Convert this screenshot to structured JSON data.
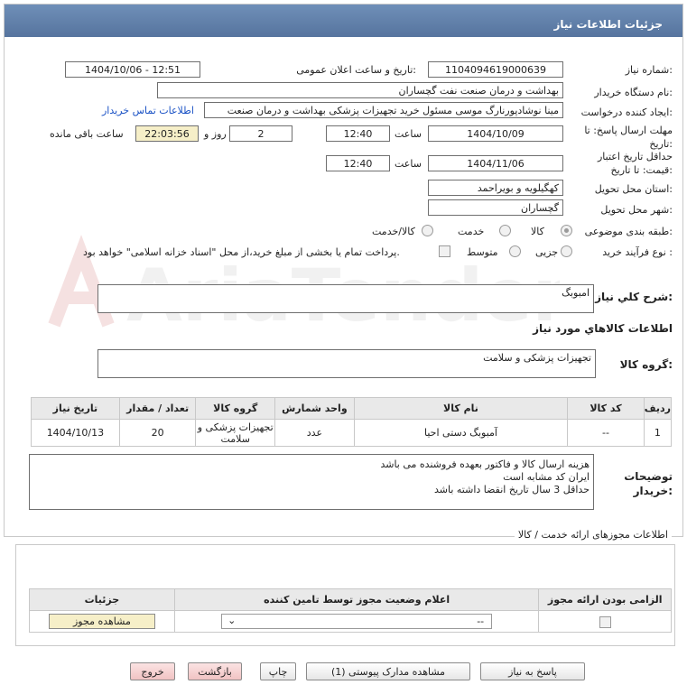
{
  "header": {
    "title": "جزئیات اطلاعات نیاز"
  },
  "fields": {
    "need_number_label": "شماره نیاز:",
    "need_number": "1104094619000639",
    "announce_label": "تاریخ و ساعت اعلان عمومی:",
    "announce_value": "1404/10/06 - 12:51",
    "buyer_label": "نام دستگاه خریدار:",
    "buyer_value": "بهداشت و درمان صنعت نفت گچساران",
    "creator_label": "ایجاد کننده درخواست:",
    "creator_value": "مینا نوشادپورنارگ موسی مسئول خرید تجهیزات پزشکی  بهداشت و درمان صنعت",
    "contact_link": "اطلاعات تماس خریدار",
    "deadline_label": "مهلت ارسال پاسخ: تا تاریخ:",
    "deadline_date": "1404/10/09",
    "time_label": "ساعت",
    "deadline_time": "12:40",
    "days_value": "2",
    "days_label": "روز و",
    "remaining_time": "22:03:56",
    "remaining_label": "ساعت باقی مانده",
    "validity_label": "حداقل تاریخ اعتبار قیمت: تا تاریخ:",
    "validity_date": "1404/11/06",
    "validity_time": "12:40",
    "province_label": "استان محل تحویل:",
    "province_value": "کهگیلویه و بویراحمد",
    "city_label": "شهر محل تحویل:",
    "city_value": "گچساران",
    "category_label": "طبقه بندی موضوعی:",
    "category_options": [
      "کالا",
      "خدمت",
      "کالا/خدمت"
    ],
    "process_label": "نوع فرآیند خرید :",
    "process_options": [
      "جزیی",
      "متوسط"
    ],
    "payment_note": "پرداخت تمام یا بخشی از مبلغ خرید،از محل \"اسناد خزانه اسلامی\" خواهد بود."
  },
  "summary": {
    "label": "شرح کلي نياز:",
    "value": "امبوبگ"
  },
  "goods_info": {
    "title": "اطلاعات کالاهاي مورد نياز"
  },
  "goods_group": {
    "label": "گروه کالا:",
    "value": "تجهیزات پزشکی و سلامت"
  },
  "goods_table": {
    "headers": [
      "ردیف",
      "کد کالا",
      "نام کالا",
      "واحد شمارش",
      "گروه کالا",
      "تعداد / مقدار",
      "تاریخ نیاز"
    ],
    "rows": [
      [
        "1",
        "--",
        "آمبوبگ دستی احیا",
        "عدد",
        "تجهیزات پزشکی و سلامت",
        "20",
        "1404/10/13"
      ]
    ]
  },
  "buyer_notes": {
    "label": "توضیحات خریدار:",
    "lines": [
      "هزینه ارسال کالا و فاکتور بعهده فروشنده می باشد",
      "ایران کد مشابه است",
      "حداقل 3 سال  تاریخ انقضا داشته باشد"
    ]
  },
  "licenses": {
    "title": "اطلاعات مجوزهای ارائه خدمت / کالا",
    "headers": [
      "الزامی بودن ارائه مجوز",
      "اعلام وضعیت مجوز توسط تامین کننده",
      "جزئیات"
    ],
    "select_value": "--",
    "view_button": "مشاهده مجوز"
  },
  "buttons": {
    "reply": "پاسخ به نیاز",
    "view_docs": "مشاهده مدارک پیوستی (1)",
    "print": "چاپ",
    "back": "بازگشت",
    "exit": "خروج"
  },
  "watermark": {
    "text": "AriaTender.net"
  },
  "colors": {
    "header": "#5f7eaa",
    "link": "#1a52c5",
    "highlight": "#f6efc8"
  }
}
